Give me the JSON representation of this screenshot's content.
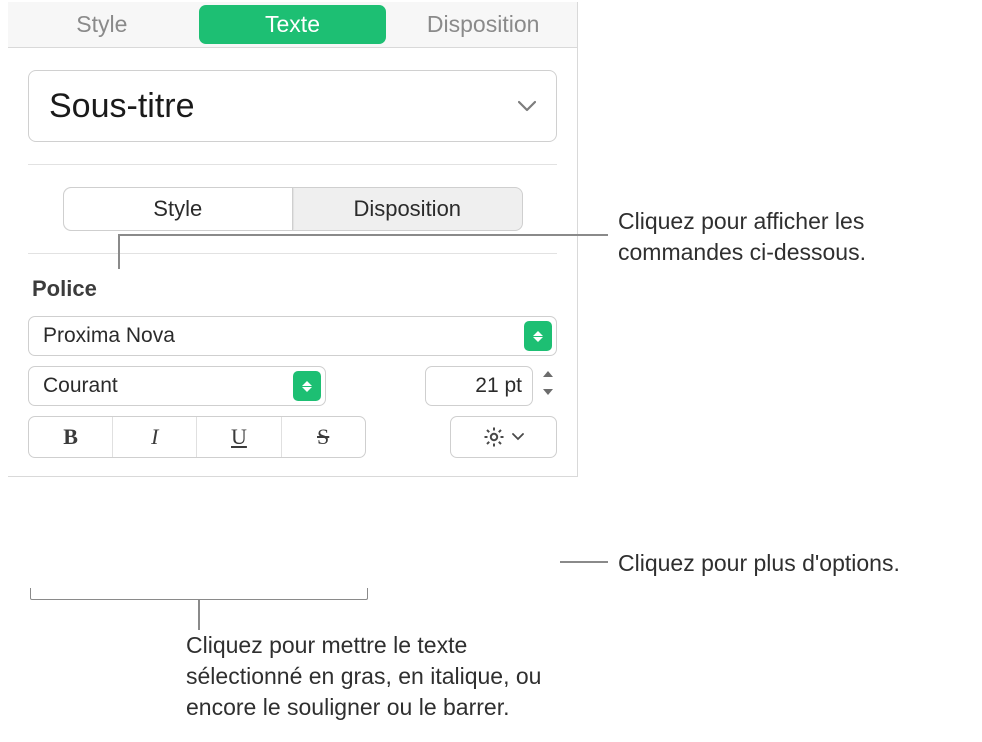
{
  "tabs": {
    "style": "Style",
    "texte": "Texte",
    "disposition": "Disposition"
  },
  "paragraph_style": "Sous-titre",
  "segmented": {
    "style": "Style",
    "disposition": "Disposition"
  },
  "font_section": "Police",
  "font_name": "Proxima Nova",
  "font_weight": "Courant",
  "font_size": "21 pt",
  "bius": {
    "b": "B",
    "i": "I",
    "u": "U",
    "s": "S"
  },
  "callouts": {
    "seg": "Cliquez pour afficher les commandes ci-dessous.",
    "adv": "Cliquez pour plus d'options.",
    "bius": "Cliquez pour mettre le texte sélectionné en gras, en italique, ou encore le souligner ou le barrer."
  }
}
